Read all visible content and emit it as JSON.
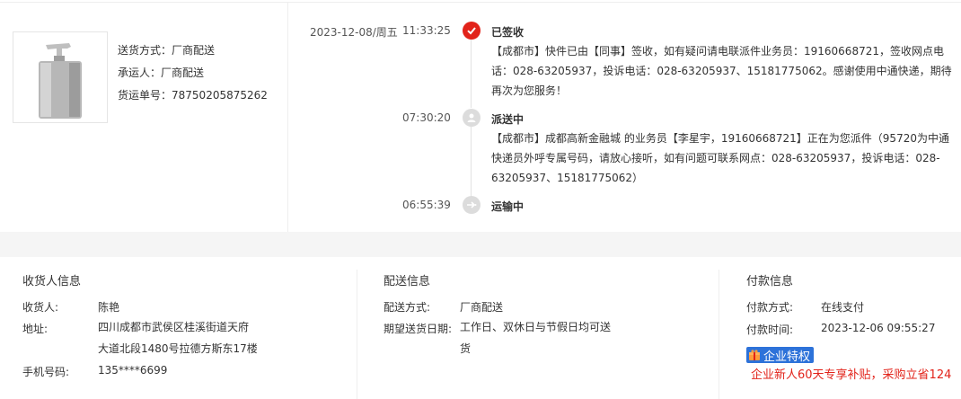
{
  "shipment": {
    "method_label": "送货方式：",
    "method_value": "厂商配送",
    "carrier_label": "承运人：",
    "carrier_value": "厂商配送",
    "tracking_label": "货运单号：",
    "tracking_value": "78750205875262"
  },
  "timeline": [
    {
      "date": "2023-12-08/周五",
      "time": "11:33:25",
      "status": "已签收",
      "desc": "【成都市】快件已由【同事】签收，如有疑问请电联派件业务员：19160668721，签收网点电话：028-63205937，投诉电话：028-63205937、15181775062。感谢使用中通快递，期待再次为您服务！",
      "icon": "check-icon"
    },
    {
      "date": "",
      "time": "07:30:20",
      "status": "派送中",
      "desc": "【成都市】成都高新金融城 的业务员【李星宇，19160668721】正在为您派件（95720为中通快递员外呼专属号码，请放心接听，如有问题可联系网点：028-63205937，投诉电话：028-63205937、15181775062）",
      "icon": "delivery-person-icon"
    },
    {
      "date": "",
      "time": "06:55:39",
      "status": "运输中",
      "desc": "",
      "icon": "transit-icon"
    }
  ],
  "receiver": {
    "title": "收货人信息",
    "name_label": "收货人:",
    "name_value": "陈艳",
    "address_label": "地址:",
    "address_line1": "四川成都市武侯区桂溪街道天府",
    "address_line2": "大道北段1480号拉德方斯东17楼",
    "phone_label": "手机号码:",
    "phone_value": "135****6699"
  },
  "delivery": {
    "title": "配送信息",
    "method_label": "配送方式:",
    "method_value": "厂商配送",
    "date_label": "期望送货日期:",
    "date_line1": "工作日、双休日与节假日均可送",
    "date_line2": "货"
  },
  "payment": {
    "title": "付款信息",
    "method_label": "付款方式:",
    "method_value": "在线支付",
    "time_label": "付款时间:",
    "time_value": "2023-12-06 09:55:27",
    "badge_text": "企业特权",
    "promo_text": "企业新人60天专享补贴，采购立省124"
  },
  "colors": {
    "accent_red": "#e2231a",
    "badge_blue": "#2d72d9",
    "band_gray": "#f5f5f5"
  }
}
